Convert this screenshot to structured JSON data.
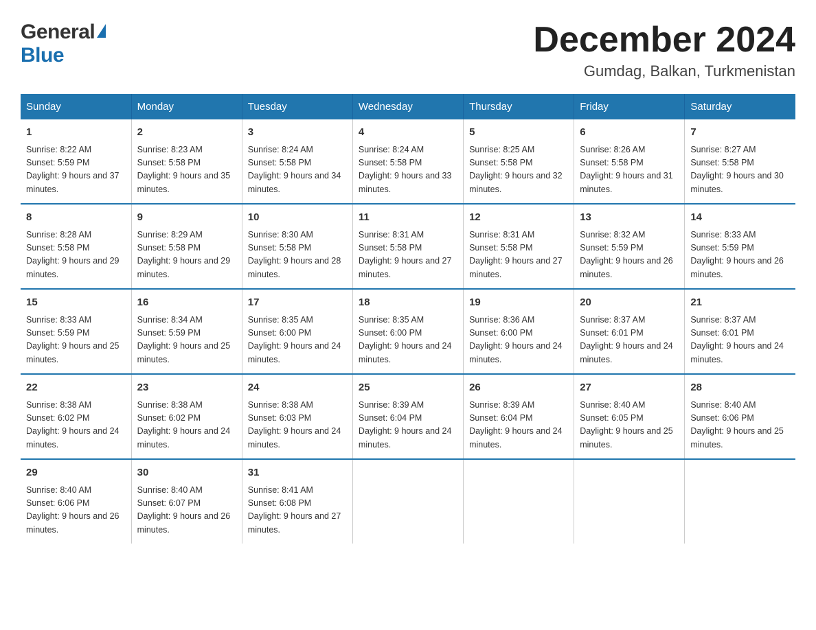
{
  "header": {
    "logo_general": "General",
    "logo_blue": "Blue",
    "month_year": "December 2024",
    "location": "Gumdag, Balkan, Turkmenistan"
  },
  "days_of_week": [
    "Sunday",
    "Monday",
    "Tuesday",
    "Wednesday",
    "Thursday",
    "Friday",
    "Saturday"
  ],
  "weeks": [
    [
      {
        "day": "1",
        "sunrise": "8:22 AM",
        "sunset": "5:59 PM",
        "daylight": "9 hours and 37 minutes."
      },
      {
        "day": "2",
        "sunrise": "8:23 AM",
        "sunset": "5:58 PM",
        "daylight": "9 hours and 35 minutes."
      },
      {
        "day": "3",
        "sunrise": "8:24 AM",
        "sunset": "5:58 PM",
        "daylight": "9 hours and 34 minutes."
      },
      {
        "day": "4",
        "sunrise": "8:24 AM",
        "sunset": "5:58 PM",
        "daylight": "9 hours and 33 minutes."
      },
      {
        "day": "5",
        "sunrise": "8:25 AM",
        "sunset": "5:58 PM",
        "daylight": "9 hours and 32 minutes."
      },
      {
        "day": "6",
        "sunrise": "8:26 AM",
        "sunset": "5:58 PM",
        "daylight": "9 hours and 31 minutes."
      },
      {
        "day": "7",
        "sunrise": "8:27 AM",
        "sunset": "5:58 PM",
        "daylight": "9 hours and 30 minutes."
      }
    ],
    [
      {
        "day": "8",
        "sunrise": "8:28 AM",
        "sunset": "5:58 PM",
        "daylight": "9 hours and 29 minutes."
      },
      {
        "day": "9",
        "sunrise": "8:29 AM",
        "sunset": "5:58 PM",
        "daylight": "9 hours and 29 minutes."
      },
      {
        "day": "10",
        "sunrise": "8:30 AM",
        "sunset": "5:58 PM",
        "daylight": "9 hours and 28 minutes."
      },
      {
        "day": "11",
        "sunrise": "8:31 AM",
        "sunset": "5:58 PM",
        "daylight": "9 hours and 27 minutes."
      },
      {
        "day": "12",
        "sunrise": "8:31 AM",
        "sunset": "5:58 PM",
        "daylight": "9 hours and 27 minutes."
      },
      {
        "day": "13",
        "sunrise": "8:32 AM",
        "sunset": "5:59 PM",
        "daylight": "9 hours and 26 minutes."
      },
      {
        "day": "14",
        "sunrise": "8:33 AM",
        "sunset": "5:59 PM",
        "daylight": "9 hours and 26 minutes."
      }
    ],
    [
      {
        "day": "15",
        "sunrise": "8:33 AM",
        "sunset": "5:59 PM",
        "daylight": "9 hours and 25 minutes."
      },
      {
        "day": "16",
        "sunrise": "8:34 AM",
        "sunset": "5:59 PM",
        "daylight": "9 hours and 25 minutes."
      },
      {
        "day": "17",
        "sunrise": "8:35 AM",
        "sunset": "6:00 PM",
        "daylight": "9 hours and 24 minutes."
      },
      {
        "day": "18",
        "sunrise": "8:35 AM",
        "sunset": "6:00 PM",
        "daylight": "9 hours and 24 minutes."
      },
      {
        "day": "19",
        "sunrise": "8:36 AM",
        "sunset": "6:00 PM",
        "daylight": "9 hours and 24 minutes."
      },
      {
        "day": "20",
        "sunrise": "8:37 AM",
        "sunset": "6:01 PM",
        "daylight": "9 hours and 24 minutes."
      },
      {
        "day": "21",
        "sunrise": "8:37 AM",
        "sunset": "6:01 PM",
        "daylight": "9 hours and 24 minutes."
      }
    ],
    [
      {
        "day": "22",
        "sunrise": "8:38 AM",
        "sunset": "6:02 PM",
        "daylight": "9 hours and 24 minutes."
      },
      {
        "day": "23",
        "sunrise": "8:38 AM",
        "sunset": "6:02 PM",
        "daylight": "9 hours and 24 minutes."
      },
      {
        "day": "24",
        "sunrise": "8:38 AM",
        "sunset": "6:03 PM",
        "daylight": "9 hours and 24 minutes."
      },
      {
        "day": "25",
        "sunrise": "8:39 AM",
        "sunset": "6:04 PM",
        "daylight": "9 hours and 24 minutes."
      },
      {
        "day": "26",
        "sunrise": "8:39 AM",
        "sunset": "6:04 PM",
        "daylight": "9 hours and 24 minutes."
      },
      {
        "day": "27",
        "sunrise": "8:40 AM",
        "sunset": "6:05 PM",
        "daylight": "9 hours and 25 minutes."
      },
      {
        "day": "28",
        "sunrise": "8:40 AM",
        "sunset": "6:06 PM",
        "daylight": "9 hours and 25 minutes."
      }
    ],
    [
      {
        "day": "29",
        "sunrise": "8:40 AM",
        "sunset": "6:06 PM",
        "daylight": "9 hours and 26 minutes."
      },
      {
        "day": "30",
        "sunrise": "8:40 AM",
        "sunset": "6:07 PM",
        "daylight": "9 hours and 26 minutes."
      },
      {
        "day": "31",
        "sunrise": "8:41 AM",
        "sunset": "6:08 PM",
        "daylight": "9 hours and 27 minutes."
      },
      {
        "day": "",
        "sunrise": "",
        "sunset": "",
        "daylight": ""
      },
      {
        "day": "",
        "sunrise": "",
        "sunset": "",
        "daylight": ""
      },
      {
        "day": "",
        "sunrise": "",
        "sunset": "",
        "daylight": ""
      },
      {
        "day": "",
        "sunrise": "",
        "sunset": "",
        "daylight": ""
      }
    ]
  ]
}
